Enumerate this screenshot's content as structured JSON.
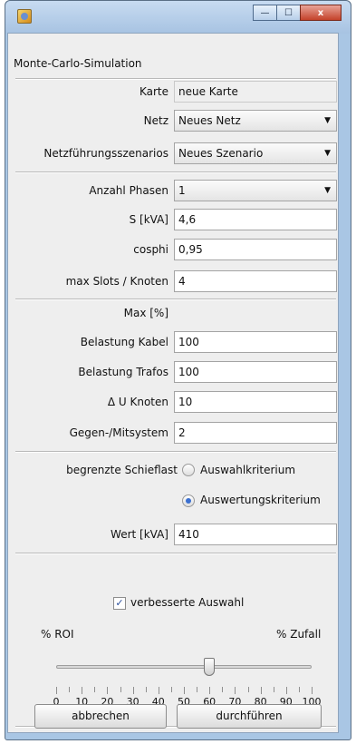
{
  "title": "Monte-Carlo-Simulation",
  "window_buttons": {
    "minimize": "—",
    "maximize": "☐",
    "close": "x"
  },
  "fields": {
    "karte": {
      "label": "Karte",
      "value": "neue Karte"
    },
    "netz": {
      "label": "Netz",
      "value": "Neues Netz"
    },
    "szenario": {
      "label": "Netzführungsszenarios",
      "value": "Neues Szenario"
    },
    "phasen": {
      "label": "Anzahl Phasen",
      "value": "1"
    },
    "s": {
      "label": "S [kVA]",
      "value": "4,6"
    },
    "cosphi": {
      "label": "cosphi",
      "value": "0,95"
    },
    "max_slots": {
      "label": "max Slots / Knoten",
      "value": "4"
    },
    "max_header": "Max [%]",
    "belastung_kabel": {
      "label": "Belastung Kabel",
      "value": "100"
    },
    "belastung_trafos": {
      "label": "Belastung Trafos",
      "value": "100"
    },
    "du_knoten": {
      "label": "Δ U Knoten",
      "value": "10"
    },
    "gegen_mitsystem": {
      "label": "Gegen-/Mitsystem",
      "value": "2"
    },
    "schieflast": {
      "label": "begrenzte Schieflast",
      "option1": "Auswahlkriterium",
      "option2": "Auswertungskriterium",
      "selected": "Auswertungskriterium"
    },
    "wert": {
      "label": "Wert [kVA]",
      "value": "410"
    },
    "verbesserte": {
      "label": "verbesserte Auswahl",
      "checked": true
    }
  },
  "slider": {
    "left_label": "% ROI",
    "right_label": "% Zufall",
    "value": 60,
    "ticks": [
      "0",
      "10",
      "20",
      "30",
      "40",
      "50",
      "60",
      "70",
      "80",
      "90",
      "100"
    ]
  },
  "buttons": {
    "cancel": "abbrechen",
    "run": "durchführen"
  },
  "icons": {
    "app": "app-icon",
    "dropdown": "chevron-down-icon",
    "check": "check-icon"
  }
}
